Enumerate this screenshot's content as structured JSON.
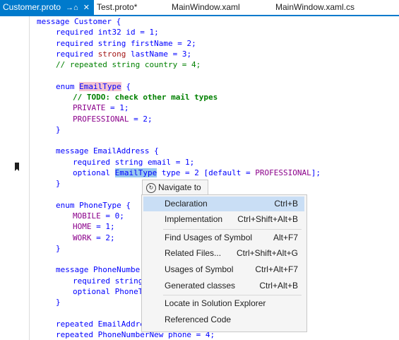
{
  "tabs": [
    {
      "label": "Customer.proto",
      "pin": "→⌂",
      "close": "✕"
    },
    {
      "label": "Test.proto*"
    },
    {
      "label": "MainWindow.xaml"
    },
    {
      "label": "MainWindow.xaml.cs"
    }
  ],
  "code": {
    "l1": "message Customer {",
    "l2a": "required",
    "l2b": "int32",
    "l2c": " id = 1;",
    "l3a": "required",
    "l3b": "string",
    "l3c": " firstName = 2;",
    "l4a": "required",
    "l4b": "strong",
    "l4c": " lastName = 3;",
    "l5": "// repeated string country = 4;",
    "l7a": "enum",
    "l7b": "EmailType",
    "l7c": " {",
    "l8": "// TODO: check other mail types",
    "l9a": "PRIVATE",
    "l9b": " = 1;",
    "l10a": "PROFESSIONAL",
    "l10b": " = 2;",
    "l11": "}",
    "l13a": "message",
    "l13b": " EmailAddress {",
    "l14a": "required",
    "l14b": "string",
    "l14c": " email = 1;",
    "l15a": "optional",
    "l15b": "EmailType",
    "l15c": " type = 2 [default = ",
    "l15d": "PROFESSIONAL",
    "l15e": "];",
    "l16": "}",
    "l18a": "enum",
    "l18b": " PhoneType {",
    "l19a": "MOBILE",
    "l19b": " = 0;",
    "l20a": "HOME",
    "l20b": " = 1;",
    "l21a": "WORK",
    "l21b": " = 2;",
    "l22": "}",
    "l24a": "message",
    "l24b": " PhoneNumber",
    "l25a": "required",
    "l25b": " string",
    "l26a": "optional",
    "l26b": " PhoneT",
    "l27": "}",
    "l29a": "repeated",
    "l29b": " EmailAddre",
    "l30a": "repeated",
    "l30b": " PhoneNumberNew phone = 4;"
  },
  "navigate": {
    "icon": "navigate-icon",
    "title": "Navigate to",
    "items": [
      {
        "label": "Declaration",
        "shortcut": "Ctrl+B"
      },
      {
        "label": "Implementation",
        "shortcut": "Ctrl+Shift+Alt+B"
      },
      {
        "label": "Find Usages of Symbol",
        "shortcut": "Alt+F7"
      },
      {
        "label": "Related Files...",
        "shortcut": "Ctrl+Shift+Alt+G"
      },
      {
        "label": "Usages of Symbol",
        "shortcut": "Ctrl+Alt+F7"
      },
      {
        "label": "Generated classes",
        "shortcut": "Ctrl+Alt+B"
      },
      {
        "label": "Locate in Solution Explorer",
        "shortcut": ""
      },
      {
        "label": "Referenced Code",
        "shortcut": ""
      }
    ]
  },
  "colors": {
    "accent": "#007acc",
    "keyword": "#0000ff",
    "comment": "#008000",
    "selection": "#c9def5"
  }
}
